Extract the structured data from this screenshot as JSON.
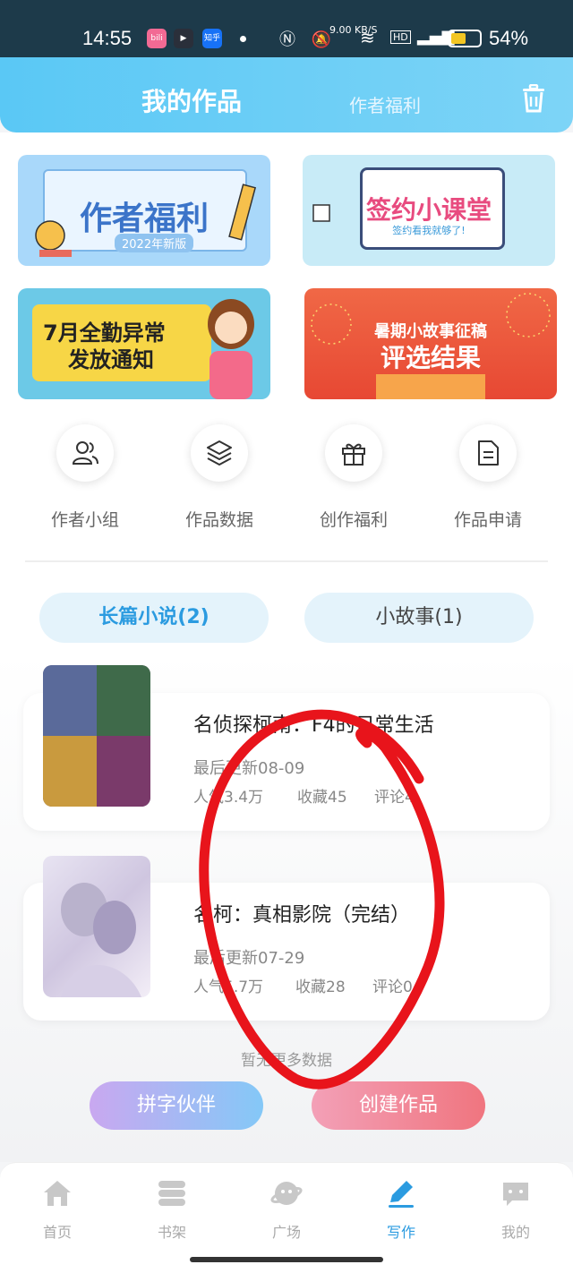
{
  "status_bar": {
    "time": "14:55",
    "app_icons": [
      "bilibili",
      "app",
      "知乎"
    ],
    "network_speed": "9.00 KB/S",
    "battery_percent": "54%",
    "battery_level": 0.54
  },
  "header": {
    "active_tab": "我的作品",
    "inactive_tab": "作者福利",
    "trash_icon": "trash-icon"
  },
  "banners": {
    "b1": {
      "title": "作者福利",
      "subtitle": "2022年新版"
    },
    "b2": {
      "title": "签约小课堂",
      "subtitle": "签约看我就够了!"
    },
    "b3": {
      "line1": "7月全勤异常",
      "line2": "发放通知"
    },
    "b4": {
      "line1": "暑期小故事征稿",
      "line2": "评选结果"
    }
  },
  "features": [
    {
      "label": "作者小组",
      "icon": "users-icon"
    },
    {
      "label": "作品数据",
      "icon": "layers-icon"
    },
    {
      "label": "创作福利",
      "icon": "gift-icon"
    },
    {
      "label": "作品申请",
      "icon": "document-icon"
    }
  ],
  "segments": {
    "long_novel": "长篇小说(2)",
    "short_story": "小故事(1)"
  },
  "works": [
    {
      "title": "名侦探柯南：F4的日常生活",
      "updated": "最后更新08-09",
      "popularity": "人气3.4万",
      "favorites": "收藏45",
      "comments": "评论4"
    },
    {
      "title": "名柯：真相影院（完结）",
      "updated": "最后更新07-29",
      "popularity": "人气5.7万",
      "favorites": "收藏28",
      "comments": "评论0"
    }
  ],
  "no_more": "暂无更多数据",
  "actions": {
    "partner": "拼字伙伴",
    "create": "创建作品"
  },
  "bottom_nav": [
    {
      "label": "首页",
      "icon": "home-icon"
    },
    {
      "label": "书架",
      "icon": "bookshelf-icon"
    },
    {
      "label": "广场",
      "icon": "planet-icon"
    },
    {
      "label": "写作",
      "icon": "pen-icon",
      "active": true
    },
    {
      "label": "我的",
      "icon": "chat-icon"
    }
  ],
  "colors": {
    "accent": "#2b9be0",
    "header": "#5ac8f5",
    "annotation": "#e8141b"
  }
}
